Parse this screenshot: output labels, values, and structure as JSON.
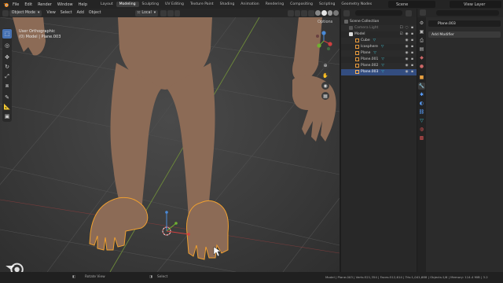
{
  "app": {
    "menu": [
      "File",
      "Edit",
      "Render",
      "Window",
      "Help"
    ],
    "workspace_tabs": [
      "Layout",
      "Modeling",
      "Sculpting",
      "UV Editing",
      "Texture Paint",
      "Shading",
      "Animation",
      "Rendering",
      "Compositing",
      "Scripting",
      "Geometry Nodes"
    ],
    "active_workspace": "Modeling",
    "scene_name": "Scene",
    "view_layer_name": "View Layer"
  },
  "viewport_header": {
    "mode": "Object Mode",
    "view": "View",
    "select": "Select",
    "add": "Add",
    "object": "Object",
    "transform_orientation": "Local",
    "options": "Options"
  },
  "viewport": {
    "view_name": "User Orthographic",
    "context": "(0) Model | Plane.003"
  },
  "outliner": {
    "header_title": "Scene Collection",
    "rows": [
      {
        "label": "Scene Collection",
        "type": "collection",
        "indent": 0
      },
      {
        "label": "Camera Light",
        "type": "collection",
        "indent": 1,
        "dimmed": true
      },
      {
        "label": "Model",
        "type": "collection",
        "indent": 1
      },
      {
        "label": "Cube",
        "type": "mesh",
        "indent": 2
      },
      {
        "label": "Icosphere",
        "type": "mesh",
        "indent": 2
      },
      {
        "label": "Plane",
        "type": "mesh",
        "indent": 2
      },
      {
        "label": "Plane.001",
        "type": "mesh",
        "indent": 2
      },
      {
        "label": "Plane.002",
        "type": "mesh",
        "indent": 2
      },
      {
        "label": "Plane.003",
        "type": "mesh",
        "indent": 2,
        "selected": true
      }
    ]
  },
  "properties": {
    "object_name": "Plane.003",
    "add_modifier": "Add Modifier"
  },
  "statusbar": {
    "left_hint": "Rotate View",
    "mid_hint": "Select",
    "stats": "Model | Plane.003 | Verts:521,354 | Faces:512,614 | Tris:1,041,688 | Objects:1/6 | Memory: 114.4 MiB | 3.2"
  },
  "watermark": "blender",
  "colors": {
    "accent": "#4772b3",
    "selection_outline": "#f0a030",
    "skin": "#8a6a55"
  }
}
